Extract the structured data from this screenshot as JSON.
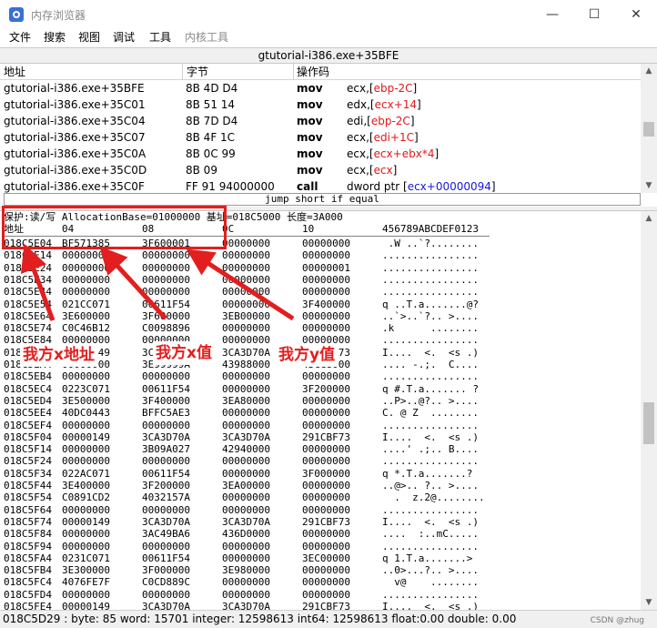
{
  "window": {
    "title": "内存浏览器",
    "minimize": "—",
    "maximize": "☐",
    "close": "✕"
  },
  "menu": [
    "文件",
    "搜索",
    "视图",
    "调试",
    "工具",
    "内核工具"
  ],
  "disasm": {
    "header": "gtutorial-i386.exe+35BFE",
    "columns": {
      "address": "地址",
      "bytes": "字节",
      "opcode": "操作码"
    },
    "rows": [
      {
        "address": "gtutorial-i386.exe+35BFE",
        "bytes": "8B 4D D4",
        "mnemonic": "mov",
        "ops": [
          [
            "ecx,[",
            ""
          ],
          [
            "ebp-2C",
            "red"
          ],
          [
            "]",
            ""
          ]
        ]
      },
      {
        "address": "gtutorial-i386.exe+35C01",
        "bytes": "8B 51 14",
        "mnemonic": "mov",
        "ops": [
          [
            "edx,[",
            ""
          ],
          [
            "ecx+14",
            "red"
          ],
          [
            "]",
            ""
          ]
        ]
      },
      {
        "address": "gtutorial-i386.exe+35C04",
        "bytes": "8B 7D D4",
        "mnemonic": "mov",
        "ops": [
          [
            "edi,[",
            ""
          ],
          [
            "ebp-2C",
            "red"
          ],
          [
            "]",
            ""
          ]
        ]
      },
      {
        "address": "gtutorial-i386.exe+35C07",
        "bytes": "8B 4F 1C",
        "mnemonic": "mov",
        "ops": [
          [
            "ecx,[",
            ""
          ],
          [
            "edi+1C",
            "red"
          ],
          [
            "]",
            ""
          ]
        ]
      },
      {
        "address": "gtutorial-i386.exe+35C0A",
        "bytes": "8B 0C 99",
        "mnemonic": "mov",
        "ops": [
          [
            "ecx,[",
            ""
          ],
          [
            "ecx+ebx*4",
            "red"
          ],
          [
            "]",
            ""
          ]
        ]
      },
      {
        "address": "gtutorial-i386.exe+35C0D",
        "bytes": "8B 09",
        "mnemonic": "mov",
        "ops": [
          [
            "ecx,[",
            ""
          ],
          [
            "ecx",
            "red"
          ],
          [
            "]",
            ""
          ]
        ]
      },
      {
        "address": "gtutorial-i386.exe+35C0F",
        "bytes": "FF 91 94000000",
        "mnemonic": "call",
        "ops": [
          [
            "dword ptr [",
            ""
          ],
          [
            "ecx+00000094",
            "blue"
          ],
          [
            "]",
            ""
          ]
        ]
      }
    ]
  },
  "jump_hint": "jump short if equal",
  "hex": {
    "info_line": "保护:读/写  AllocationBase=01000000 基址=018C5000 长度=3A000",
    "header": {
      "address": "地址",
      "c1": "04",
      "c2": "08",
      "c3": "0C",
      "c4": "10",
      "ascii": "456789ABCDEF0123"
    },
    "rows": [
      [
        "018C5E04",
        "BF571385",
        "3F600001",
        "00000000",
        "00000000",
        " .W ..`?........"
      ],
      [
        "018C5E14",
        "00000000",
        "00000000",
        "00000000",
        "00000000",
        "................"
      ],
      [
        "018C5E24",
        "00000000",
        "00000000",
        "00000000",
        "00000001",
        "................"
      ],
      [
        "018C5E34",
        "00000000",
        "00000000",
        "00000000",
        "00000000",
        "................"
      ],
      [
        "018C5E44",
        "00000000",
        "00000000",
        "00000000",
        "00000000",
        "................"
      ],
      [
        "018C5E54",
        "021CC071",
        "00611F54",
        "00000000",
        "3F400000",
        "q ..T.a.......@?"
      ],
      [
        "018C5E64",
        "3E600000",
        "3F600000",
        "3EB00000",
        "00000000",
        "..`>..`?.. >...."
      ],
      [
        "018C5E74",
        "C0C46B12",
        "C0098896",
        "00000000",
        "00000000",
        ".k      ........"
      ],
      [
        "018C5E84",
        "00000000",
        "00000000",
        "00000000",
        "00000000",
        "................"
      ],
      [
        "018C5E94",
        "00000149",
        "3CA3D70A",
        "3CA3D70A",
        "291CBF73",
        "I....  <.  <s .)"
      ],
      [
        "018C5EA4",
        "00000000",
        "3E99999A",
        "43988000",
        "43CC8000",
        ".... -.;.  C...."
      ],
      [
        "018C5EB4",
        "00000000",
        "00000000",
        "00000000",
        "00000000",
        "................"
      ],
      [
        "018C5EC4",
        "0223C071",
        "00611F54",
        "00000000",
        "3F200000",
        "q #.T.a....... ?"
      ],
      [
        "018C5ED4",
        "3E500000",
        "3F400000",
        "3EA80000",
        "00000000",
        "..P>..@?.. >...."
      ],
      [
        "018C5EE4",
        "40DC0443",
        "BFFC5AE3",
        "00000000",
        "00000000",
        "C. @ Z  ........"
      ],
      [
        "018C5EF4",
        "00000000",
        "00000000",
        "00000000",
        "00000000",
        "................"
      ],
      [
        "018C5F04",
        "00000149",
        "3CA3D70A",
        "3CA3D70A",
        "291CBF73",
        "I....  <.  <s .)"
      ],
      [
        "018C5F14",
        "00000000",
        "3B09A027",
        "42940000",
        "00000000",
        "....' .;.. B...."
      ],
      [
        "018C5F24",
        "00000000",
        "00000000",
        "00000000",
        "00000000",
        "................"
      ],
      [
        "018C5F34",
        "022AC071",
        "00611F54",
        "00000000",
        "3F000000",
        "q *.T.a.......?"
      ],
      [
        "018C5F44",
        "3E400000",
        "3F200000",
        "3EA00000",
        "00000000",
        "..@>.. ?.. >...."
      ],
      [
        "018C5F54",
        "C0891CD2",
        "4032157A",
        "00000000",
        "00000000",
        "  .  z.2@........"
      ],
      [
        "018C5F64",
        "00000000",
        "00000000",
        "00000000",
        "00000000",
        "................"
      ],
      [
        "018C5F74",
        "00000149",
        "3CA3D70A",
        "3CA3D70A",
        "291CBF73",
        "I....  <.  <s .)"
      ],
      [
        "018C5F84",
        "00000000",
        "3AC49BA6",
        "436D0000",
        "00000000",
        "....  :..mC....."
      ],
      [
        "018C5F94",
        "00000000",
        "00000000",
        "00000000",
        "00000000",
        "................"
      ],
      [
        "018C5FA4",
        "0231C071",
        "00611F54",
        "00000000",
        "3EC00000",
        "q 1.T.a.......>"
      ],
      [
        "018C5FB4",
        "3E300000",
        "3F000000",
        "3E980000",
        "00000000",
        "..0>...?.. >...."
      ],
      [
        "018C5FC4",
        "4076FE7F",
        "C0CD889C",
        "00000000",
        "00000000",
        "  v@    ........"
      ],
      [
        "018C5FD4",
        "00000000",
        "00000000",
        "00000000",
        "00000000",
        "................"
      ],
      [
        "018C5FE4",
        "00000149",
        "3CA3D70A",
        "3CA3D70A",
        "291CBF73",
        "I....  <.  <s .)"
      ]
    ]
  },
  "status": "018C5D29 : byte: 85 word: 15701 integer: 12598613 int64: 12598613 float:0.00 double: 0.00",
  "watermark": "CSDN @zhug",
  "annotations": {
    "x_address": "我方x地址",
    "x_value": "我方x值",
    "y_value": "我方y值"
  },
  "colors": {
    "annotation": "#e31e1e",
    "register_red": "#e01818",
    "operand_blue": "#1818d8"
  }
}
